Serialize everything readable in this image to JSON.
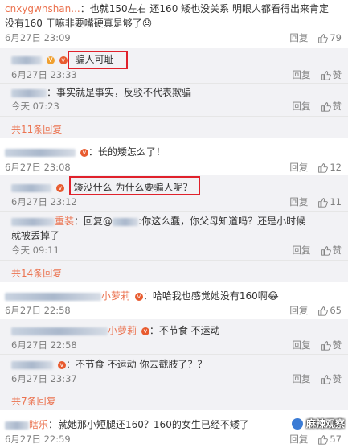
{
  "c1": {
    "user": "cnxygwhshan...",
    "text": "：也就150左右 还160 矮也没关系 明眼人都看得出来肯定",
    "text2": "没有160 干嘛非要嘴硬真是够了",
    "emoji": "😓",
    "time": "6月27日 23:09",
    "reply": "回复",
    "likes": "79"
  },
  "r1": {
    "text": "骗人可耻",
    "time": "6月27日 23:33",
    "reply": "回复",
    "like": "赞"
  },
  "r2": {
    "text": "：事实就是事实，反驳不代表欺骗",
    "time": "今天 07:23",
    "reply": "回复",
    "like": "赞"
  },
  "more1": "共11条回复",
  "c2": {
    "text": "：长的矮怎么了！",
    "time": "6月27日 23:08",
    "reply": "回复",
    "likes": "12"
  },
  "r3": {
    "text": "矮没什么 为什么要骗人呢？",
    "time": "6月27日 23:12",
    "reply": "回复",
    "likes": "11"
  },
  "r4": {
    "user": "重装",
    "text_a": "：回复@",
    "text_b": ":你这么蠢，你父母知道吗？还是小时候",
    "text2": "就被丢掉了",
    "time": "今天 09:11",
    "reply": "回复",
    "like": "赞"
  },
  "more2": "共14条回复",
  "c3": {
    "user": "小萝莉",
    "text": "：哈哈我也感觉她没有160啊",
    "emoji": "😂",
    "time": "6月27日 22:58",
    "reply": "回复",
    "likes": "65"
  },
  "r5": {
    "user": "小萝莉",
    "text": "：不节食 不运动",
    "time": "6月27日 22:58",
    "reply": "回复",
    "like": "赞"
  },
  "r6": {
    "text": "：不节食 不运动 你去截肢了？？",
    "time": "6月27日 23:37",
    "reply": "回复",
    "like": "赞"
  },
  "more3": "共7条回复",
  "c4": {
    "user": "瞎乐",
    "text": "：就她那小短腿还160？160的女生已经不矮了",
    "time": "6月27日 22:59",
    "reply": "回复",
    "likes": "57"
  },
  "watermark": "麻辣观察"
}
